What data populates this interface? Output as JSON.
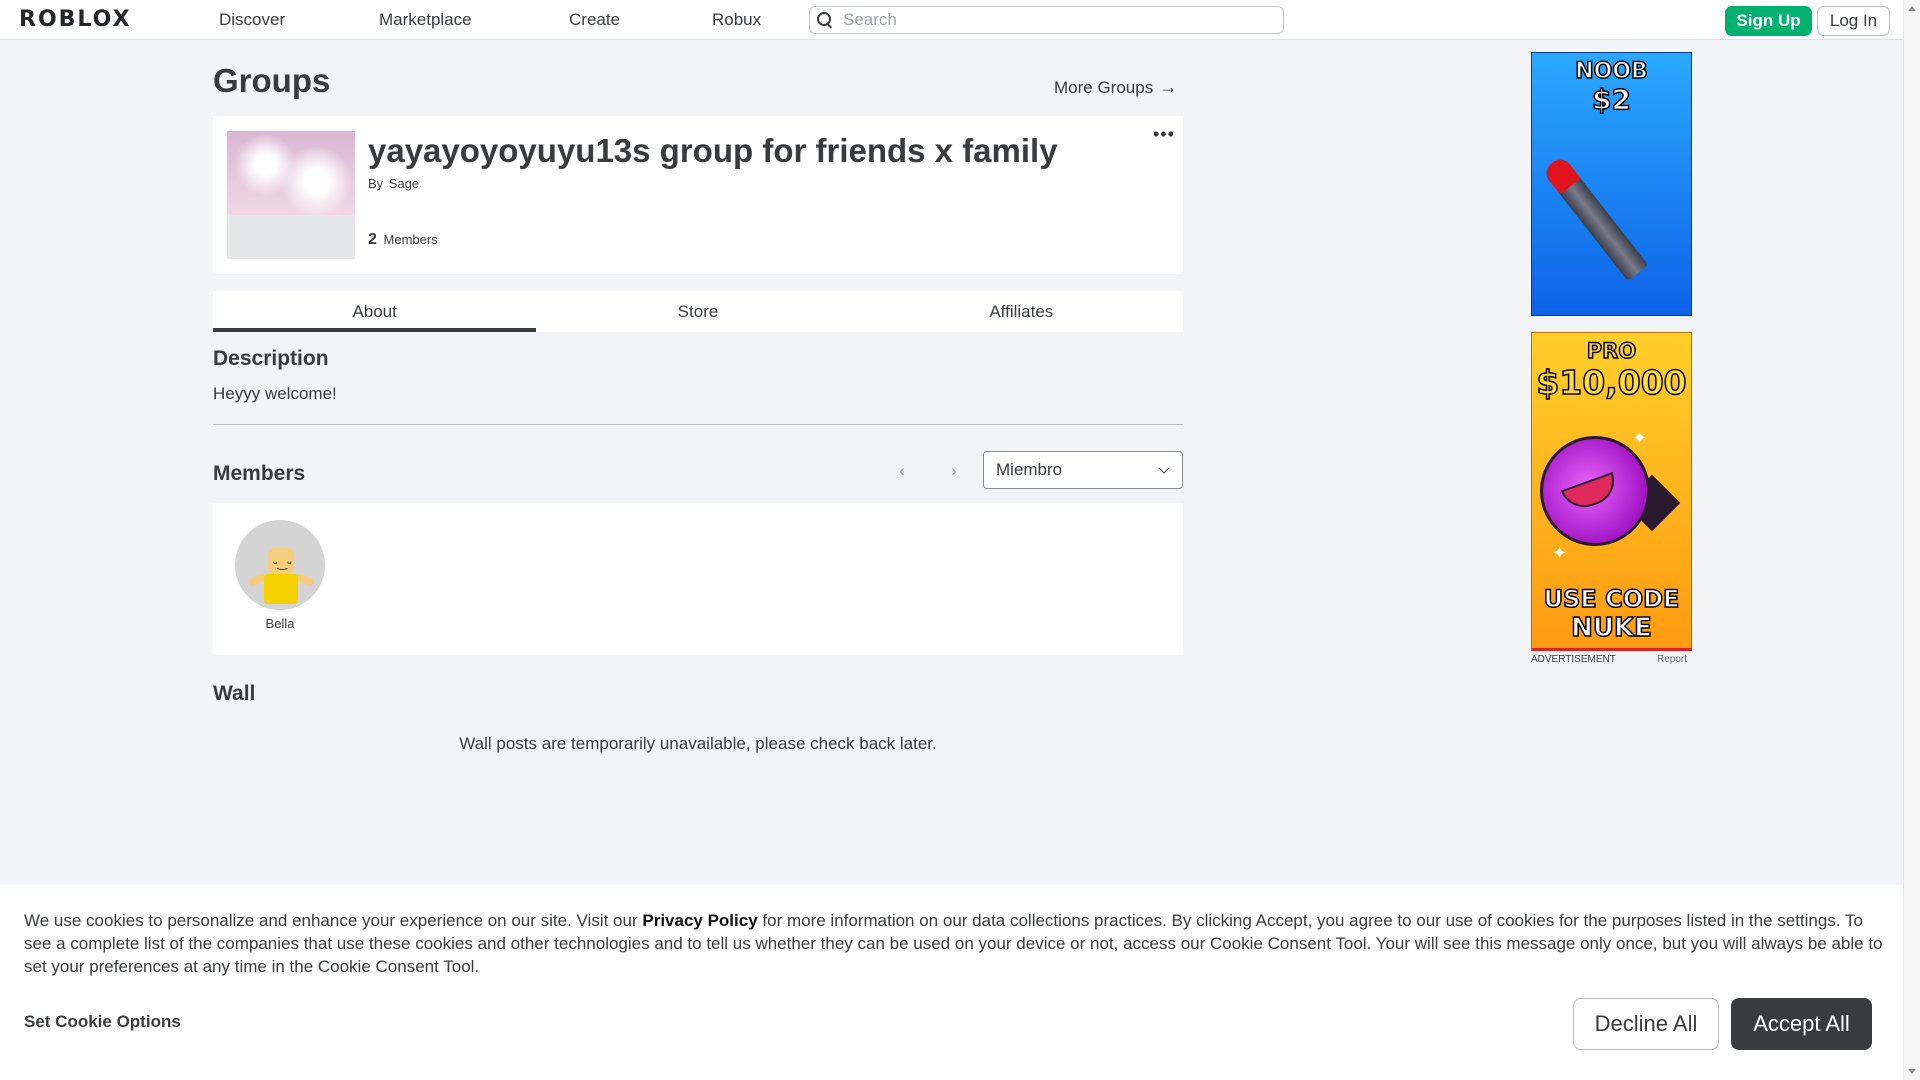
{
  "nav": {
    "logo": "ROBLOX",
    "links": [
      "Discover",
      "Marketplace",
      "Create",
      "Robux"
    ],
    "search_placeholder": "Search",
    "sign_up": "Sign Up",
    "log_in": "Log In"
  },
  "page": {
    "title": "Groups",
    "more_groups": "More Groups",
    "more_groups_arrow": "→"
  },
  "group": {
    "name": "yayayoyoyuyu13s group for friends x family",
    "by_label": "By",
    "owner": "Sage",
    "member_count": "2",
    "members_label": "Members",
    "more_menu": "•••"
  },
  "tabs": [
    "About",
    "Store",
    "Affiliates"
  ],
  "active_tab": "About",
  "about": {
    "description_heading": "Description",
    "description_text": "Heyyy welcome!",
    "members_heading": "Members",
    "role_selected": "Miembro",
    "members": [
      {
        "name": "Bella"
      }
    ],
    "wall_heading": "Wall",
    "wall_message": "Wall posts are temporarily unavailable, please check back later."
  },
  "ads": {
    "ad1": {
      "line1": "NOOB",
      "line2": "$2"
    },
    "ad2": {
      "line1": "PRO",
      "line2": "$10,000",
      "line3": "USE CODE",
      "line4": "NUKE"
    },
    "label": "ADVERTISEMENT",
    "report": "Report"
  },
  "cookie": {
    "text_before": "We use cookies to personalize and enhance your experience on our site. Visit our ",
    "privacy_link": "Privacy Policy",
    "text_after": " for more information on our data collections practices. By clicking Accept, you agree to our use of cookies for the purposes listed in the settings. To see a complete list of the companies that use these cookies and other technologies and to tell us whether they can be used on your device or not, access our Cookie Consent Tool. Your will see this message only once, but you will always be able to set your preferences at any time in the Cookie Consent Tool.",
    "set_options": "Set Cookie Options",
    "decline": "Decline All",
    "accept": "Accept All"
  },
  "colors": {
    "accent_green": "#00b06f",
    "dark": "#393b3d",
    "background": "#f2f4f5"
  }
}
